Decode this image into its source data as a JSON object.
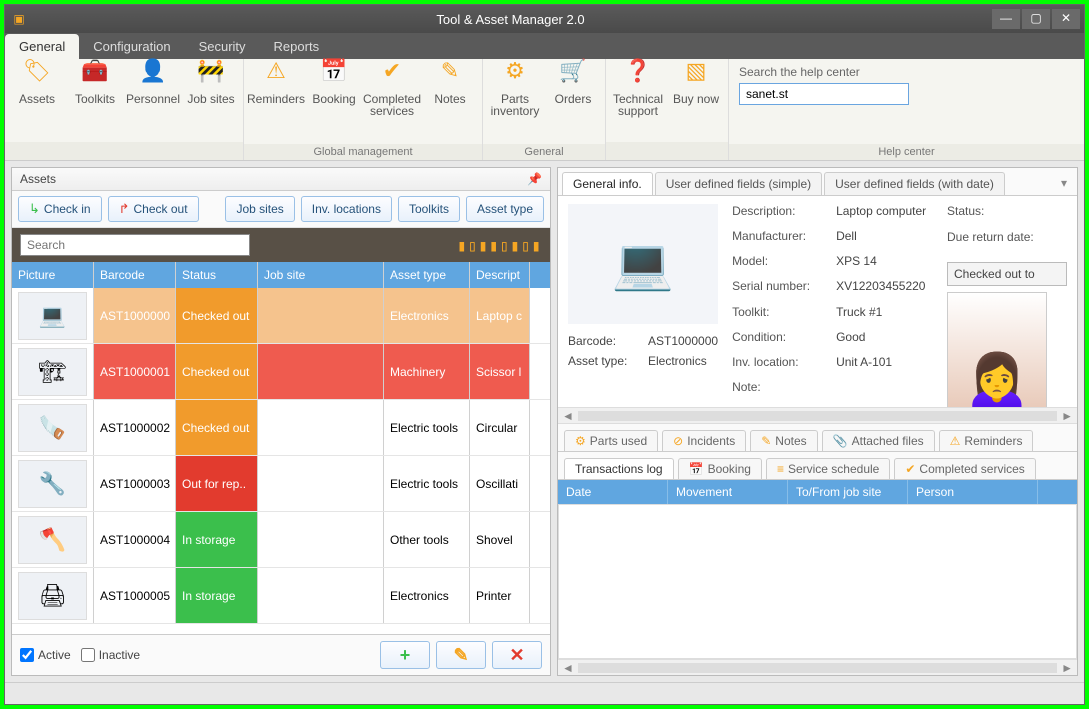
{
  "title": "Tool & Asset Manager 2.0",
  "menuTabs": [
    "General",
    "Configuration",
    "Security",
    "Reports"
  ],
  "ribbonGroups": {
    "g1": {
      "label": "",
      "buttons": [
        {
          "label": "Assets",
          "icon": "🏷"
        },
        {
          "label": "Toolkits",
          "icon": "🧰"
        },
        {
          "label": "Personnel",
          "icon": "👤"
        },
        {
          "label": "Job sites",
          "icon": "🚧"
        }
      ]
    },
    "g2": {
      "label": "Global management",
      "buttons": [
        {
          "label": "Reminders",
          "icon": "⚠"
        },
        {
          "label": "Booking",
          "icon": "📅"
        },
        {
          "label": "Completed services",
          "icon": "✔"
        },
        {
          "label": "Notes",
          "icon": "✎"
        }
      ]
    },
    "g3": {
      "label": "General",
      "buttons": [
        {
          "label": "Parts inventory",
          "icon": "⚙"
        },
        {
          "label": "Orders",
          "icon": "🛒"
        }
      ]
    },
    "g4": {
      "label": "",
      "buttons": [
        {
          "label": "Technical support",
          "icon": "❓"
        },
        {
          "label": "Buy now",
          "icon": "▧"
        }
      ]
    },
    "help": {
      "label": "Search the help center",
      "value": "sanet.st",
      "group": "Help center"
    }
  },
  "assetsPanel": {
    "title": "Assets",
    "checkIn": "Check in",
    "checkOut": "Check out",
    "jobSites": "Job sites",
    "invLocations": "Inv. locations",
    "toolkits": "Toolkits",
    "assetType": "Asset type",
    "searchPlaceholder": "Search",
    "columns": [
      "Picture",
      "Barcode",
      "Status",
      "Job site",
      "Asset type",
      "Descript"
    ],
    "rows": [
      {
        "icon": "💻",
        "bc": "AST1000000",
        "st": "Checked out",
        "js": "",
        "at": "Electronics",
        "de": "Laptop c",
        "cls": "sel"
      },
      {
        "icon": "🏗",
        "bc": "AST1000001",
        "st": "Checked out",
        "js": "",
        "at": "Machinery",
        "de": "Scissor l",
        "cls": "red"
      },
      {
        "icon": "🪚",
        "bc": "AST1000002",
        "st": "Checked out",
        "js": "",
        "at": "Electric tools",
        "de": "Circular",
        "cls": "",
        "stcls": "st-out"
      },
      {
        "icon": "🔧",
        "bc": "AST1000003",
        "st": "Out for rep..",
        "js": "",
        "at": "Electric tools",
        "de": "Oscillati",
        "cls": "",
        "stcls": "st-rep"
      },
      {
        "icon": "🪓",
        "bc": "AST1000004",
        "st": "In storage",
        "js": "",
        "at": "Other tools",
        "de": "Shovel",
        "cls": "",
        "stcls": "st-sto"
      },
      {
        "icon": "🖨",
        "bc": "AST1000005",
        "st": "In storage",
        "js": "",
        "at": "Electronics",
        "de": "Printer",
        "cls": "",
        "stcls": "st-sto"
      }
    ],
    "active": "Active",
    "inactive": "Inactive"
  },
  "detailTabs": [
    "General info.",
    "User defined fields (simple)",
    "User defined fields (with date)"
  ],
  "detail": {
    "barcodeK": "Barcode:",
    "barcodeV": "AST1000000",
    "assetTypeK": "Asset type:",
    "assetTypeV": "Electronics",
    "descK": "Description:",
    "descV": "Laptop computer",
    "manuK": "Manufacturer:",
    "manuV": "Dell",
    "modelK": "Model:",
    "modelV": "XPS 14",
    "snK": "Serial number:",
    "snV": "XV12203455220",
    "tkK": "Toolkit:",
    "tkV": "Truck #1",
    "condK": "Condition:",
    "condV": "Good",
    "invK": "Inv. location:",
    "invV": "Unit A-101",
    "noteK": "Note:",
    "noteV": "",
    "statusK": "Status:",
    "dueK": "Due return date:",
    "statusBox": "Checked out to"
  },
  "subTabs1": [
    "Parts used",
    "Incidents",
    "Notes",
    "Attached files",
    "Reminders"
  ],
  "subTabs2": [
    "Transactions log",
    "Booking",
    "Service schedule",
    "Completed services"
  ],
  "logCols": [
    "Date",
    "Movement",
    "To/From job site",
    "Person"
  ]
}
